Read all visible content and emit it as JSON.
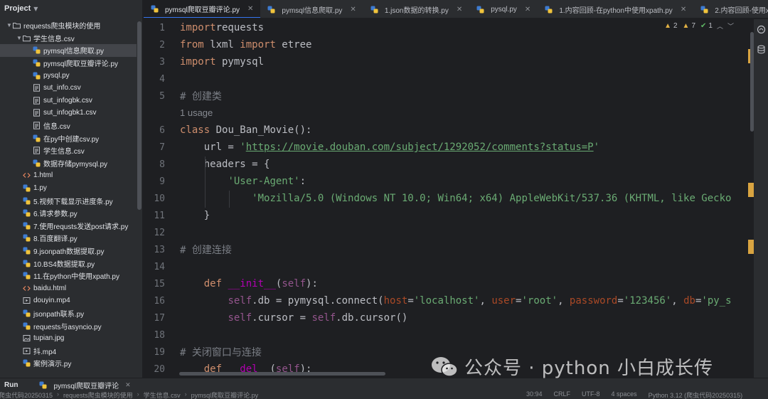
{
  "project_panel": {
    "title": "Project",
    "tree": [
      {
        "label": "requests爬虫模块的使用",
        "type": "folder",
        "expanded": true,
        "depth": 1
      },
      {
        "label": "学生信息.csv",
        "type": "folder",
        "expanded": true,
        "depth": 2
      },
      {
        "label": "pymsql信息爬取.py",
        "type": "py",
        "depth": 3,
        "selected": true
      },
      {
        "label": "pymsql爬取豆瓣评论.py",
        "type": "py",
        "depth": 3
      },
      {
        "label": "pysql.py",
        "type": "py",
        "depth": 3
      },
      {
        "label": "sut_info.csv",
        "type": "csv",
        "depth": 3
      },
      {
        "label": "sut_infogbk.csv",
        "type": "csv",
        "depth": 3
      },
      {
        "label": "sut_infogbk1.csv",
        "type": "csv",
        "depth": 3
      },
      {
        "label": "信息.csv",
        "type": "csv",
        "depth": 3
      },
      {
        "label": "在py中创建csv.py",
        "type": "py",
        "depth": 3
      },
      {
        "label": "学生信息.csv",
        "type": "csv",
        "depth": 3
      },
      {
        "label": "数据存储pymysql.py",
        "type": "py",
        "depth": 3
      },
      {
        "label": "1.html",
        "type": "html",
        "depth": 2
      },
      {
        "label": "1.py",
        "type": "py",
        "depth": 2
      },
      {
        "label": "5.视频下载显示进度条.py",
        "type": "py",
        "depth": 2
      },
      {
        "label": "6.请求参数.py",
        "type": "py",
        "depth": 2
      },
      {
        "label": "7.使用requsts发送post请求.py",
        "type": "py",
        "depth": 2
      },
      {
        "label": "8.百度翻译.py",
        "type": "py",
        "depth": 2
      },
      {
        "label": "9.jsonpath数据提取.py",
        "type": "py",
        "depth": 2
      },
      {
        "label": "10.BS4数据提取.py",
        "type": "py",
        "depth": 2
      },
      {
        "label": "11.在python中使用xpath.py",
        "type": "py",
        "depth": 2
      },
      {
        "label": "baidu.html",
        "type": "html",
        "depth": 2
      },
      {
        "label": "douyin.mp4",
        "type": "media",
        "depth": 2
      },
      {
        "label": "jsonpath联系.py",
        "type": "py",
        "depth": 2
      },
      {
        "label": "requests与asyncio.py",
        "type": "py",
        "depth": 2
      },
      {
        "label": "tupian.jpg",
        "type": "image",
        "depth": 2
      },
      {
        "label": "抖.mp4",
        "type": "media",
        "depth": 2
      },
      {
        "label": "案例演示.py",
        "type": "py",
        "depth": 2
      }
    ]
  },
  "tabs": [
    {
      "label": "pymsql爬取豆瓣评论.py",
      "active": true
    },
    {
      "label": "pymsql信息爬取.py",
      "active": false
    },
    {
      "label": "1.json数据的转换.py",
      "active": false
    },
    {
      "label": "pysql.py",
      "active": false
    },
    {
      "label": "1.内容回顾-在python中使用xpath.py",
      "active": false
    },
    {
      "label": "2.内容回顾-使用xpath",
      "active": false
    }
  ],
  "inspection": {
    "warnings": "2",
    "weak_warnings": "7",
    "ok": "1"
  },
  "editor": {
    "usage_hint": "1 usage",
    "lines": [
      {
        "n": "1",
        "tokens": [
          [
            "kw",
            "import"
          ],
          [
            "",
            "requests"
          ]
        ]
      },
      {
        "n": "2",
        "tokens": [
          [
            "kw",
            "from"
          ],
          [
            "",
            " lxml "
          ],
          [
            "kw",
            "import"
          ],
          [
            "",
            " etree"
          ]
        ]
      },
      {
        "n": "3",
        "tokens": [
          [
            "kw",
            "import"
          ],
          [
            "",
            " pymysql"
          ]
        ]
      },
      {
        "n": "4",
        "tokens": []
      },
      {
        "n": "5",
        "tokens": [
          [
            "cmt",
            "# 创建类"
          ]
        ]
      },
      {
        "n": "6",
        "tokens": [
          [
            "kw",
            "class"
          ],
          [
            "",
            " Dou_Ban_Movie():"
          ]
        ]
      },
      {
        "n": "7",
        "tokens": [
          [
            "",
            "    url = "
          ],
          [
            "str",
            "'"
          ],
          [
            "str url",
            "https://movie.douban.com/subject/1292052/comments?status=P"
          ],
          [
            "str",
            "'"
          ]
        ]
      },
      {
        "n": "8",
        "tokens": [
          [
            "",
            "    headers = {"
          ]
        ]
      },
      {
        "n": "9",
        "tokens": [
          [
            "",
            "        "
          ],
          [
            "str",
            "'User-Agent'"
          ],
          [
            "",
            ":"
          ]
        ]
      },
      {
        "n": "10",
        "tokens": [
          [
            "",
            "            "
          ],
          [
            "str",
            "'Mozilla/5.0 (Windows NT 10.0; Win64; x64) AppleWebKit/537.36 (KHTML, like Gecko"
          ]
        ]
      },
      {
        "n": "11",
        "tokens": [
          [
            "",
            "    }"
          ]
        ]
      },
      {
        "n": "12",
        "tokens": []
      },
      {
        "n": "13",
        "tokens": [
          [
            "cmt",
            "# 创建连接"
          ]
        ]
      },
      {
        "n": "14",
        "tokens": []
      },
      {
        "n": "15",
        "tokens": [
          [
            "",
            "    "
          ],
          [
            "kw",
            "def"
          ],
          [
            "",
            " "
          ],
          [
            "magic",
            "__init__"
          ],
          [
            "",
            "("
          ],
          [
            "selfkw",
            "self"
          ],
          [
            "",
            "):"
          ]
        ]
      },
      {
        "n": "16",
        "tokens": [
          [
            "",
            "        "
          ],
          [
            "selfkw",
            "self"
          ],
          [
            "",
            ".db = pymysql.connect("
          ],
          [
            "param",
            "host"
          ],
          [
            "",
            "="
          ],
          [
            "str",
            "'localhost'"
          ],
          [
            "",
            ", "
          ],
          [
            "param",
            "user"
          ],
          [
            "",
            "="
          ],
          [
            "str",
            "'root'"
          ],
          [
            "",
            ", "
          ],
          [
            "param",
            "password"
          ],
          [
            "",
            "="
          ],
          [
            "str",
            "'123456'"
          ],
          [
            "",
            ", "
          ],
          [
            "param",
            "db"
          ],
          [
            "",
            "="
          ],
          [
            "str",
            "'py_s"
          ]
        ]
      },
      {
        "n": "17",
        "tokens": [
          [
            "",
            "        "
          ],
          [
            "selfkw",
            "self"
          ],
          [
            "",
            ".cursor = "
          ],
          [
            "selfkw",
            "self"
          ],
          [
            "",
            ".db.cursor()"
          ]
        ]
      },
      {
        "n": "18",
        "tokens": []
      },
      {
        "n": "19",
        "tokens": [
          [
            "cmt",
            "# 关闭窗口与连接"
          ]
        ]
      },
      {
        "n": "20",
        "tokens": [
          [
            "",
            "    "
          ],
          [
            "kw",
            "def"
          ],
          [
            "",
            " "
          ],
          [
            "magic",
            "__del__"
          ],
          [
            "",
            "("
          ],
          [
            "selfkw",
            "self"
          ],
          [
            "",
            "):"
          ]
        ]
      }
    ]
  },
  "run_bar": {
    "label": "Run",
    "tab_label": "pymsql爬取豆瓣评论"
  },
  "status_bar": {
    "breadcrumbs": [
      "爬虫代码20250315",
      "requests爬虫模块的使用",
      "学生信息.csv",
      "pymsql爬取豆瓣评论.py"
    ],
    "position": "30:94",
    "line_sep": "CRLF",
    "encoding": "UTF-8",
    "indent": "4 spaces",
    "interpreter": "Python 3.12 (爬虫代码20250315)"
  },
  "watermark": {
    "text": "公众号 · python 小白成长传"
  },
  "colors": {
    "keyword": "#cf8e6d",
    "string": "#6aab73",
    "comment": "#7a7e85",
    "accent": "#3574f0",
    "marker": "#d9a441"
  }
}
